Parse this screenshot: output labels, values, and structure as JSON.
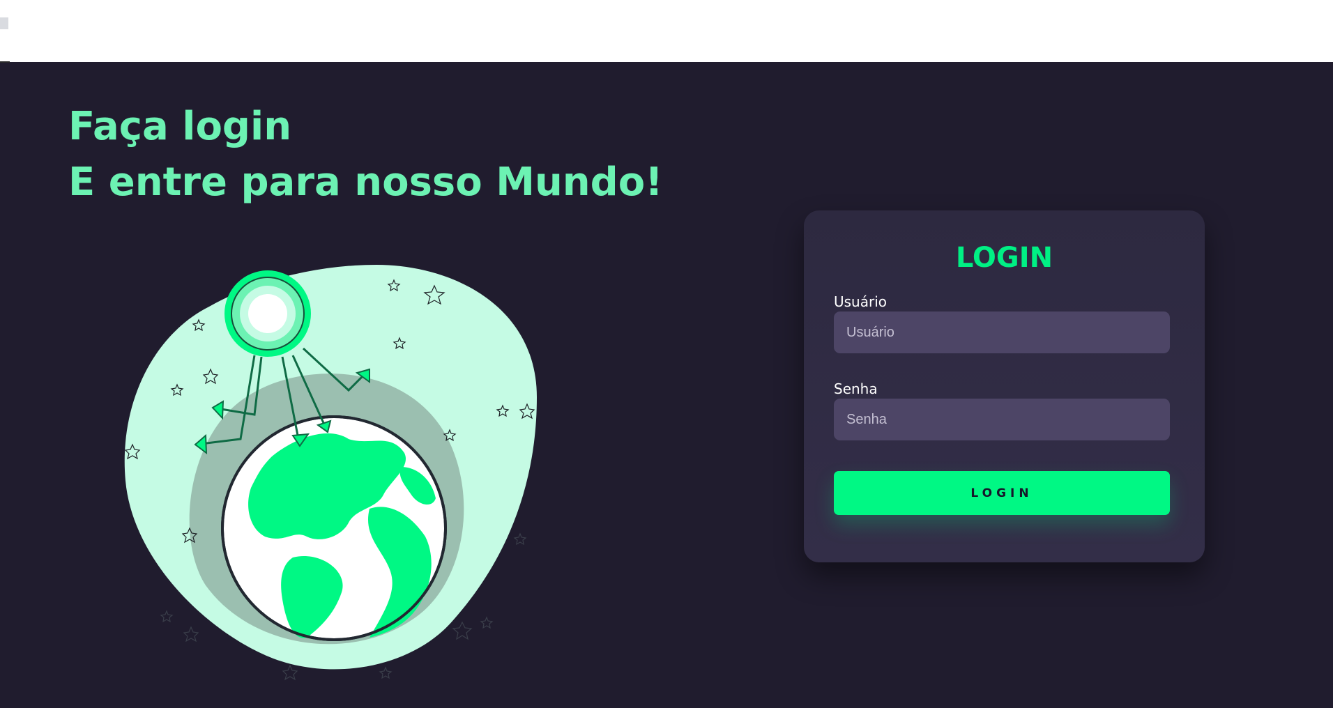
{
  "hero": {
    "line1": "Faça login",
    "line2": "E entre para nosso Mundo!"
  },
  "login": {
    "title": "LOGIN",
    "username": {
      "label": "Usuário",
      "placeholder": "Usuário",
      "value": ""
    },
    "password": {
      "label": "Senha",
      "placeholder": "Senha",
      "value": ""
    },
    "button_label": "LOGIN"
  },
  "colors": {
    "background": "#201c2e",
    "accent": "#00f884",
    "heading": "#6cf2b3",
    "card": "#2d2940",
    "input": "#4d4566"
  },
  "icons": {
    "illustration": "globe-with-sun-icon"
  }
}
